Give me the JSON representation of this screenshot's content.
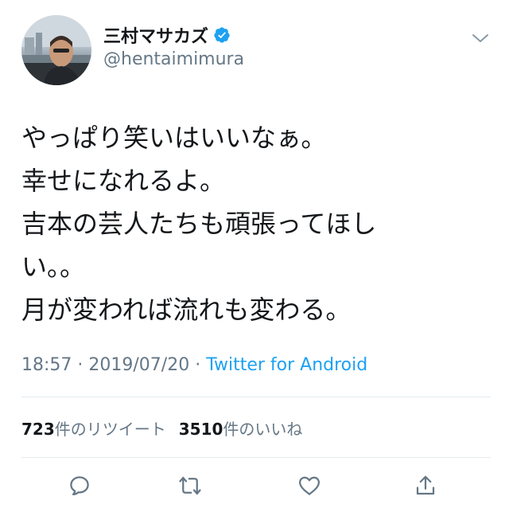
{
  "user": {
    "display_name": "三村マサカズ",
    "handle": "@hentaimimura",
    "verified": true
  },
  "icons": {
    "verified": "verified-badge-icon",
    "more": "chevron-down-icon",
    "reply": "reply-icon",
    "retweet": "retweet-icon",
    "like": "heart-icon",
    "share": "share-icon"
  },
  "tweet": {
    "lines": [
      "やっぱり笑いはいいなぁ。",
      "幸せになれるよ。",
      "吉本の芸人たちも頑張ってほし",
      "い。。",
      "月が変われば流れも変わる。"
    ],
    "time": "18:57",
    "separator": " · ",
    "date": "2019/07/20",
    "source": "Twitter for Android"
  },
  "stats": {
    "retweets_count": "723",
    "retweets_label": "件のリツイート",
    "likes_count": "3510",
    "likes_label": "件のいいね"
  },
  "colors": {
    "accent": "#1da1f2",
    "secondary_text": "#657786",
    "primary_text": "#14171a",
    "divider": "#e6ecf0"
  }
}
